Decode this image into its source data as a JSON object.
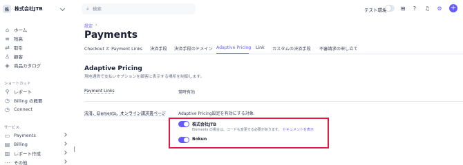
{
  "sidebar": {
    "account": {
      "logo": "株",
      "name": "株式会社JTB",
      "icon": "chevron-down-icon"
    },
    "primary": [
      {
        "label": "ホーム",
        "icon": "home-icon"
      },
      {
        "label": "残高",
        "icon": "balance-icon"
      },
      {
        "label": "取引",
        "icon": "transactions-icon"
      },
      {
        "label": "顧客",
        "icon": "customers-icon"
      },
      {
        "label": "商品カタログ",
        "icon": "product-catalog-icon"
      }
    ],
    "shortcuts_label": "ショートカット",
    "shortcuts": [
      {
        "label": "レポート",
        "icon": "pin-icon"
      },
      {
        "label": "Billing の概要",
        "icon": "clock-icon"
      },
      {
        "label": "Connect",
        "icon": "clock-icon"
      }
    ],
    "services_label": "サービス",
    "services": [
      {
        "label": "Payments",
        "icon": "payments-icon"
      },
      {
        "label": "Billing",
        "icon": "billing-icon"
      },
      {
        "label": "レポート作成",
        "icon": "reports-icon"
      },
      {
        "label": "その他",
        "icon": "more-icon"
      }
    ]
  },
  "topbar": {
    "search_placeholder": "検索",
    "test_mode_label": "テスト環境",
    "test_mode_on": false,
    "icons": [
      "apps-icon",
      "help-icon",
      "notifications-icon",
      "settings-icon",
      "add-icon"
    ]
  },
  "breadcrumb": {
    "parent": "設定",
    "sep": "›"
  },
  "page_title": "Payments",
  "tabs": [
    {
      "label": "Checkout と Payment Links",
      "active": false
    },
    {
      "label": "決済手段",
      "active": false
    },
    {
      "label": "決済手段のドメイン",
      "active": false
    },
    {
      "label": "Adaptive Pricing",
      "active": true
    },
    {
      "label": "Link",
      "active": false
    },
    {
      "label": "カスタムの決済手段",
      "active": false
    },
    {
      "label": "不審請求の申し立て",
      "active": false
    }
  ],
  "section": {
    "title": "Adaptive Pricing",
    "description": "現地通貨で支払いオプションを顧客に表示する場所を制御します。",
    "rows": [
      {
        "label": "Payment Links",
        "value": "常時有効"
      },
      {
        "label": "決済、Elements、オンライン請求書ページ",
        "value": "Adaptive Pricing設定を有効にする対象:"
      }
    ],
    "targets": [
      {
        "name": "株式会社JTB",
        "enabled": true,
        "desc": "Elements の場合は、コードも変更する必要があります。",
        "link": "ドキュメントを表示"
      },
      {
        "name": "Bokun",
        "enabled": true
      }
    ]
  },
  "colors": {
    "accent": "#635bff",
    "highlight": "#df1b41",
    "text": "#1a1f36",
    "muted": "#697386"
  }
}
